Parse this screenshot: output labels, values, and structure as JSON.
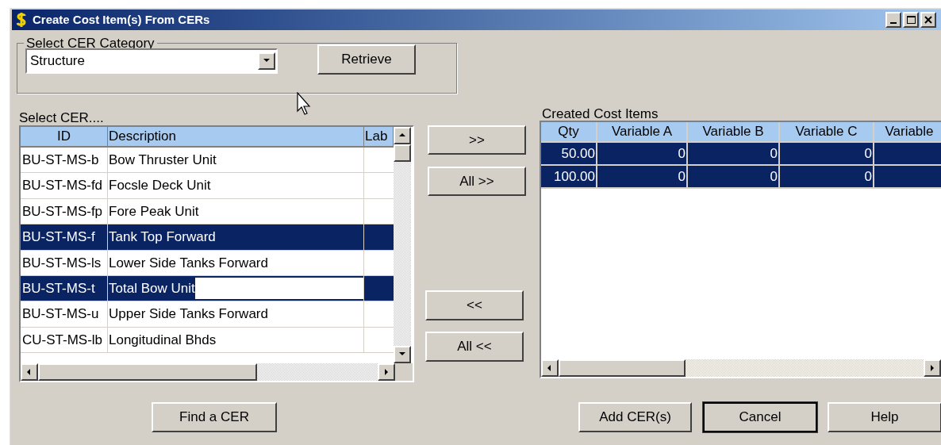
{
  "window": {
    "title": "Create Cost Item(s) From CERs"
  },
  "category_group": {
    "legend": "Select CER Category",
    "value": "Structure",
    "retrieve_button": "Retrieve"
  },
  "cer_list": {
    "label": "Select CER....",
    "columns": [
      "ID",
      "Description",
      "Lab"
    ],
    "rows": [
      {
        "id": "BU-ST-MS-b",
        "description": "Bow Thruster Unit",
        "selected": false,
        "editing": false
      },
      {
        "id": "BU-ST-MS-fd",
        "description": "Focsle Deck Unit",
        "selected": false,
        "editing": false
      },
      {
        "id": "BU-ST-MS-fp",
        "description": "Fore Peak Unit",
        "selected": false,
        "editing": false
      },
      {
        "id": "BU-ST-MS-f",
        "description": "Tank Top Forward",
        "selected": true,
        "editing": false
      },
      {
        "id": "BU-ST-MS-ls",
        "description": "Lower Side Tanks Forward",
        "selected": false,
        "editing": false
      },
      {
        "id": "BU-ST-MS-t",
        "description": "Total Bow Unit",
        "selected": true,
        "editing": true
      },
      {
        "id": "BU-ST-MS-u",
        "description": "Upper Side Tanks Forward",
        "selected": false,
        "editing": false
      },
      {
        "id": "CU-ST-MS-lb",
        "description": "Longitudinal Bhds",
        "selected": false,
        "editing": false
      }
    ]
  },
  "transfer_buttons": [
    ">>",
    "All >>",
    "<<",
    "All <<"
  ],
  "cost_items": {
    "label": "Created Cost Items",
    "columns": [
      "Qty",
      "Variable A",
      "Variable B",
      "Variable C",
      "Variable"
    ],
    "rows": [
      {
        "cells": [
          "50.00",
          "0",
          "0",
          "0"
        ],
        "selected": true
      },
      {
        "cells": [
          "100.00",
          "0",
          "0",
          "0"
        ],
        "selected": true
      }
    ]
  },
  "footer_buttons": [
    {
      "label": "Find a CER",
      "default": false
    },
    {
      "label": "Add CER(s)",
      "default": false
    },
    {
      "label": "Cancel",
      "default": true
    },
    {
      "label": "Help",
      "default": false
    }
  ]
}
